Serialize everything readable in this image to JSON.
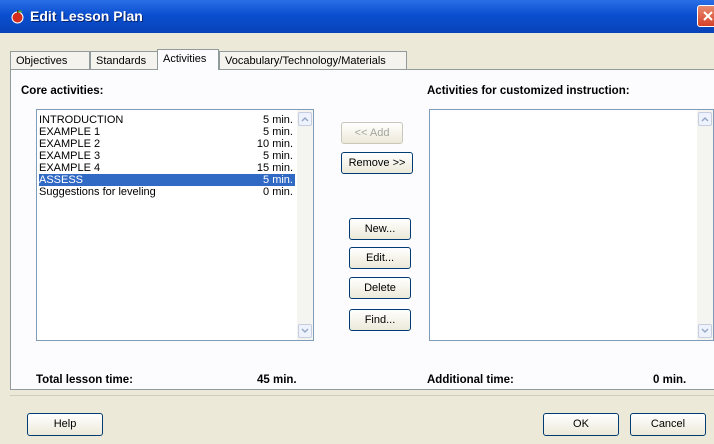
{
  "window": {
    "title": "Edit Lesson Plan"
  },
  "tabs": [
    {
      "label": "Objectives"
    },
    {
      "label": "Standards"
    },
    {
      "label": "Activities"
    },
    {
      "label": "Vocabulary/Technology/Materials"
    }
  ],
  "core": {
    "heading": "Core activities:",
    "items": [
      {
        "name": "INTRODUCTION",
        "time": "5 min."
      },
      {
        "name": "EXAMPLE 1",
        "time": "5 min."
      },
      {
        "name": "EXAMPLE 2",
        "time": "10 min."
      },
      {
        "name": "EXAMPLE 3",
        "time": "5 min."
      },
      {
        "name": "EXAMPLE 4",
        "time": "15 min."
      },
      {
        "name": "ASSESS",
        "time": "5 min."
      },
      {
        "name": "Suggestions for leveling",
        "time": "0 min."
      }
    ]
  },
  "custom": {
    "heading": "Activities for customized instruction:"
  },
  "buttons": {
    "add": "<< Add",
    "remove": "Remove >>",
    "new": "New...",
    "edit": "Edit...",
    "delete": "Delete",
    "find": "Find...",
    "help": "Help",
    "ok": "OK",
    "cancel": "Cancel"
  },
  "totals": {
    "total_label": "Total lesson time:",
    "total_value": "45 min.",
    "additional_label": "Additional time:",
    "additional_value": "0 min."
  },
  "colors": {
    "selection": "#316ac5",
    "title_bar": "#0a4fd0"
  }
}
